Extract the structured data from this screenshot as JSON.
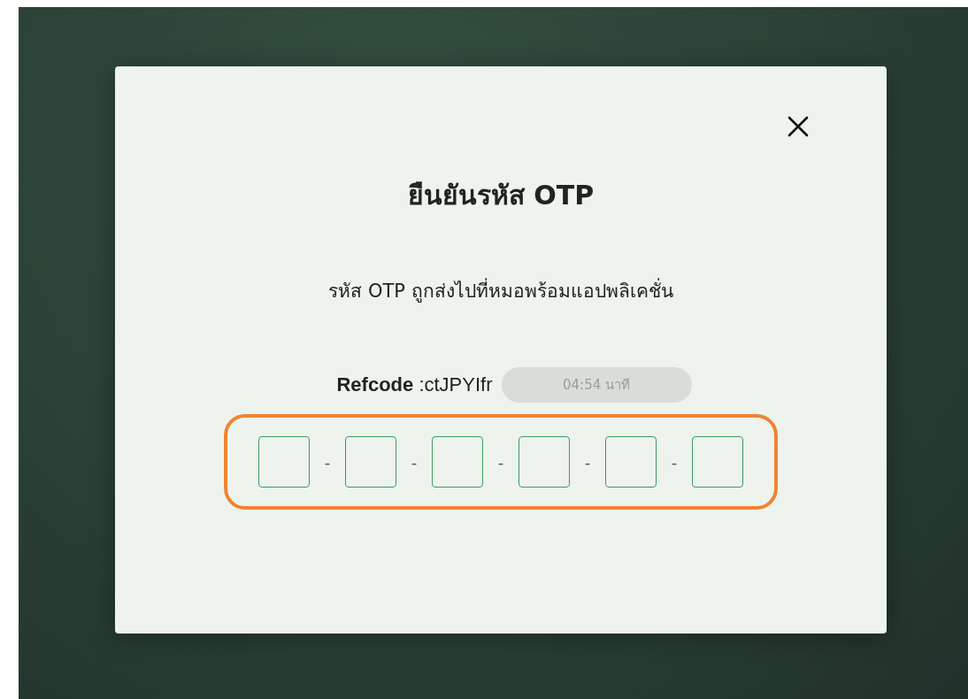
{
  "dialog": {
    "title": "ยืนยันรหัส OTP",
    "message": "รหัส OTP ถูกส่งไปที่หมอพร้อมแอปพลิเคชั่น",
    "refcode": "**Refcode** :ctJPYIfr",
    "timer": "04:54 นาที",
    "otp": {
      "separator": "-",
      "highlighted": true,
      "boxes": [
        {
          "kind": "digit"
        },
        {
          "kind": "digit"
        },
        {
          "kind": "digit"
        },
        {
          "kind": "digit"
        },
        {
          "kind": "digit"
        },
        {
          "kind": "digit"
        }
      ]
    }
  }
}
